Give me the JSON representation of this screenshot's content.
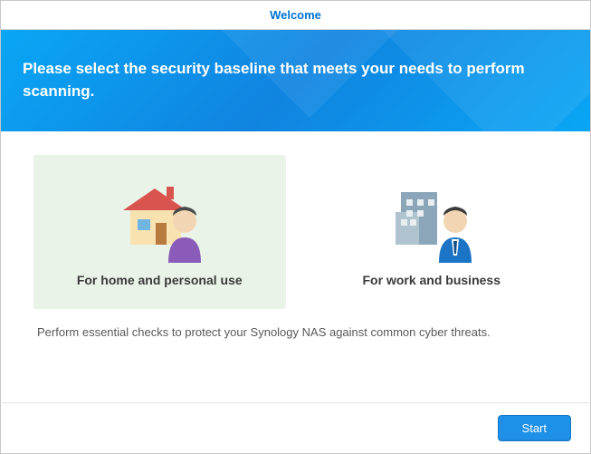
{
  "window": {
    "title": "Welcome"
  },
  "banner": {
    "heading": "Please select the security baseline that meets your needs to perform scanning."
  },
  "options": {
    "home": {
      "label": "For home and personal use",
      "selected": true,
      "icon": "home-person-icon",
      "description": "Perform essential checks to protect your Synology NAS against common cyber threats."
    },
    "business": {
      "label": "For work and business",
      "selected": false,
      "icon": "office-person-icon"
    }
  },
  "footer": {
    "start_label": "Start"
  },
  "colors": {
    "accent": "#1e90e8",
    "selected_bg": "#eaf3e8"
  }
}
